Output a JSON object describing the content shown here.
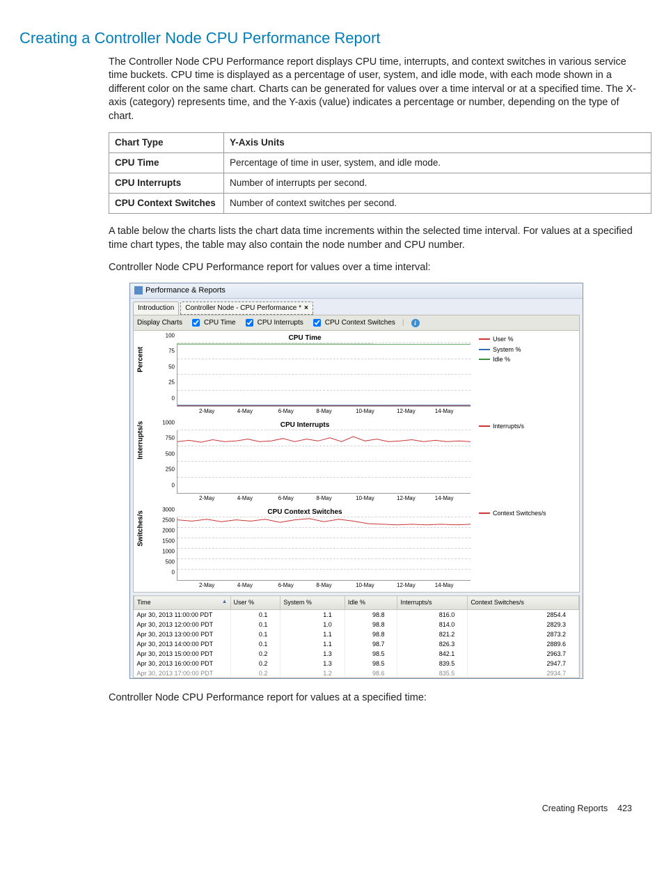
{
  "heading": "Creating a Controller Node CPU Performance Report",
  "intro": "The Controller Node CPU Performance report displays CPU time, interrupts, and context switches in various service time buckets. CPU time is displayed as a percentage of user, system, and idle mode, with each mode shown in a different color on the same chart. Charts can be generated for values over a time interval or at a specified time. The X-axis (category) represents time, and the Y-axis (value) indicates a percentage or number, depending on the type of chart.",
  "chart_info_table": {
    "headers": [
      "Chart Type",
      "Y-Axis Units"
    ],
    "rows": [
      [
        "CPU Time",
        "Percentage of time in user, system, and idle mode."
      ],
      [
        "CPU Interrupts",
        "Number of interrupts per second."
      ],
      [
        "CPU Context Switches",
        "Number of context switches per second."
      ]
    ]
  },
  "para2": "A table below the charts lists the chart data time increments within the selected time interval. For values at a specified time chart types, the table may also contain the node number and CPU number.",
  "caption1": "Controller Node CPU Performance report for values over a time interval:",
  "caption2": "Controller Node CPU Performance report for values at a specified time:",
  "screenshot": {
    "window_title": "Performance & Reports",
    "tabs": [
      "Introduction",
      "Controller Node - CPU Performance *"
    ],
    "toolbar": {
      "label": "Display Charts",
      "checks": [
        "CPU Time",
        "CPU Interrupts",
        "CPU Context Switches"
      ]
    },
    "charts": [
      {
        "title": "CPU Time",
        "ylabel": "Percent",
        "yticks": [
          0,
          25,
          50,
          75,
          100
        ],
        "xticks": [
          "2-May",
          "4-May",
          "6-May",
          "8-May",
          "10-May",
          "12-May",
          "14-May"
        ],
        "legend": [
          {
            "name": "User %",
            "color": "#cc3333"
          },
          {
            "name": "System %",
            "color": "#2e6db3"
          },
          {
            "name": "Idle %",
            "color": "#3a8f3a"
          }
        ]
      },
      {
        "title": "CPU Interrupts",
        "ylabel": "Interrupts/s",
        "yticks": [
          0,
          250,
          500,
          750,
          1000
        ],
        "xticks": [
          "2-May",
          "4-May",
          "6-May",
          "8-May",
          "10-May",
          "12-May",
          "14-May"
        ],
        "legend": [
          {
            "name": "Interrupts/s",
            "color": "#cc3333"
          }
        ]
      },
      {
        "title": "CPU Context Switches",
        "ylabel": "Switches/s",
        "yticks": [
          0,
          500,
          1000,
          1500,
          2000,
          2500,
          3000
        ],
        "xticks": [
          "2-May",
          "4-May",
          "6-May",
          "8-May",
          "10-May",
          "12-May",
          "14-May"
        ],
        "legend": [
          {
            "name": "Context Switches/s",
            "color": "#cc3333"
          }
        ]
      }
    ],
    "data_table": {
      "headers": [
        "Time",
        "User %",
        "System %",
        "Idle %",
        "Interrupts/s",
        "Context Switches/s"
      ],
      "sort_col": 0,
      "sort_dir": "asc",
      "rows": [
        [
          "Apr 30, 2013 11:00:00 PDT",
          "0.1",
          "1.1",
          "98.8",
          "816.0",
          "2854.4"
        ],
        [
          "Apr 30, 2013 12:00:00 PDT",
          "0.1",
          "1.0",
          "98.8",
          "814.0",
          "2829.3"
        ],
        [
          "Apr 30, 2013 13:00:00 PDT",
          "0.1",
          "1.1",
          "98.8",
          "821.2",
          "2873.2"
        ],
        [
          "Apr 30, 2013 14:00:00 PDT",
          "0.1",
          "1.1",
          "98.7",
          "826.3",
          "2889.6"
        ],
        [
          "Apr 30, 2013 15:00:00 PDT",
          "0.2",
          "1.3",
          "98.5",
          "842.1",
          "2963.7"
        ],
        [
          "Apr 30, 2013 16:00:00 PDT",
          "0.2",
          "1.3",
          "98.5",
          "839.5",
          "2947.7"
        ],
        [
          "Apr 30, 2013 17:00:00 PDT",
          "0.2",
          "1.2",
          "98.6",
          "835.5",
          "2934.7"
        ]
      ]
    }
  },
  "footer": {
    "section": "Creating Reports",
    "page": "423"
  },
  "chart_data": [
    {
      "type": "line",
      "title": "CPU Time",
      "xlabel": "",
      "ylabel": "Percent",
      "ylim": [
        0,
        100
      ],
      "categories": [
        "2-May",
        "4-May",
        "6-May",
        "8-May",
        "10-May",
        "12-May",
        "14-May"
      ],
      "series": [
        {
          "name": "User %",
          "values": [
            0.1,
            0.1,
            0.1,
            0.1,
            0.2,
            0.2,
            0.2
          ]
        },
        {
          "name": "System %",
          "values": [
            1.1,
            1.0,
            1.1,
            1.1,
            1.3,
            1.3,
            1.2
          ]
        },
        {
          "name": "Idle %",
          "values": [
            98.8,
            98.8,
            98.8,
            98.7,
            98.5,
            98.5,
            98.6
          ]
        }
      ]
    },
    {
      "type": "line",
      "title": "CPU Interrupts",
      "xlabel": "",
      "ylabel": "Interrupts/s",
      "ylim": [
        0,
        1000
      ],
      "categories": [
        "2-May",
        "4-May",
        "6-May",
        "8-May",
        "10-May",
        "12-May",
        "14-May"
      ],
      "series": [
        {
          "name": "Interrupts/s",
          "values": [
            820,
            820,
            830,
            860,
            900,
            840,
            840
          ]
        }
      ]
    },
    {
      "type": "line",
      "title": "CPU Context Switches",
      "xlabel": "",
      "ylabel": "Switches/s",
      "ylim": [
        0,
        3000
      ],
      "categories": [
        "2-May",
        "4-May",
        "6-May",
        "8-May",
        "10-May",
        "12-May",
        "14-May"
      ],
      "series": [
        {
          "name": "Context Switches/s",
          "values": [
            2900,
            2870,
            2900,
            2950,
            2960,
            2700,
            2700
          ]
        }
      ]
    }
  ]
}
